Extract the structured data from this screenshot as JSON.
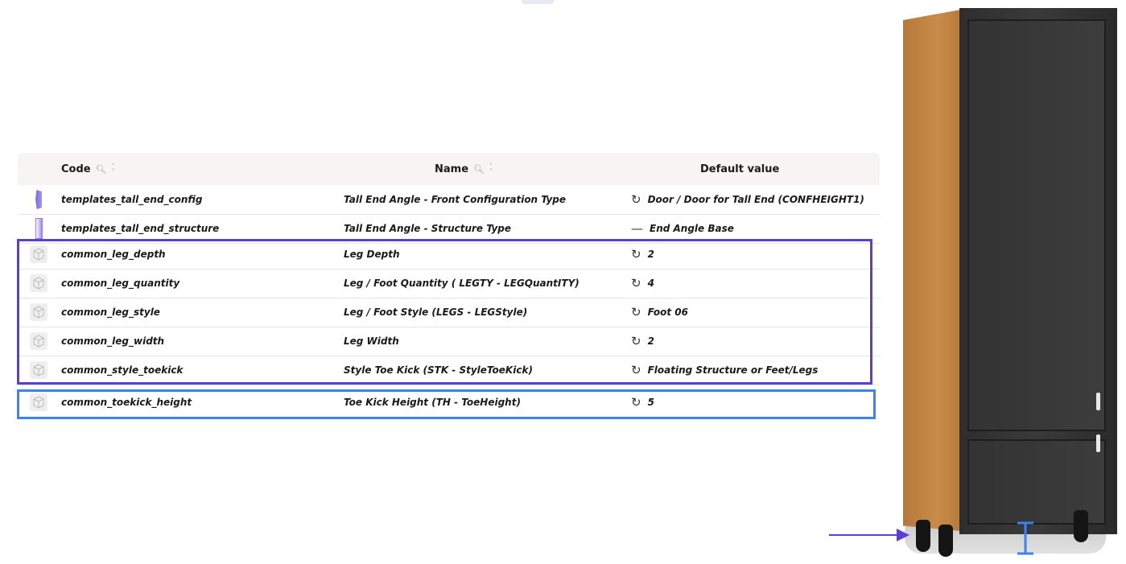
{
  "table": {
    "headers": {
      "code": "Code",
      "name": "Name",
      "default_value": "Default value"
    },
    "rows": [
      {
        "code": "templates_tall_end_config",
        "name": "Tall End Angle - Front Configuration Type",
        "icon": "reset-icon",
        "icon_glyph": "↻",
        "default": "Door / Door for Tall End (CONFHEIGHT1)"
      },
      {
        "code": "templates_tall_end_structure",
        "name": "Tall End Angle - Structure Type",
        "icon": "dash-icon",
        "icon_glyph": "—",
        "default": "End Angle Base"
      },
      {
        "code": "common_leg_depth",
        "name": "Leg Depth",
        "icon": "reset-icon",
        "icon_glyph": "↻",
        "default": "2"
      },
      {
        "code": "common_leg_quantity",
        "name": "Leg / Foot Quantity ( LEGTY - LEGQuantITY)",
        "icon": "reset-icon",
        "icon_glyph": "↻",
        "default": "4"
      },
      {
        "code": "common_leg_style",
        "name": "Leg / Foot Style (LEGS - LEGStyle)",
        "icon": "reset-icon",
        "icon_glyph": "↻",
        "default": "Foot 06"
      },
      {
        "code": "common_leg_width",
        "name": "Leg Width",
        "icon": "reset-icon",
        "icon_glyph": "↻",
        "default": "2"
      },
      {
        "code": "common_style_toekick",
        "name": "Style Toe Kick (STK - StyleToeKick)",
        "icon": "reset-icon",
        "icon_glyph": "↻",
        "default": "Floating Structure or Feet/Legs"
      },
      {
        "code": "common_toekick_height",
        "name": "Toe Kick Height (TH - ToeHeight)",
        "icon": "reset-icon",
        "icon_glyph": "↻",
        "default": "5"
      }
    ]
  },
  "colors": {
    "highlight_purple": "#5b3fd4",
    "highlight_blue": "#3b82f6",
    "cabinet_front": "#333333",
    "cabinet_side": "#c08440"
  }
}
